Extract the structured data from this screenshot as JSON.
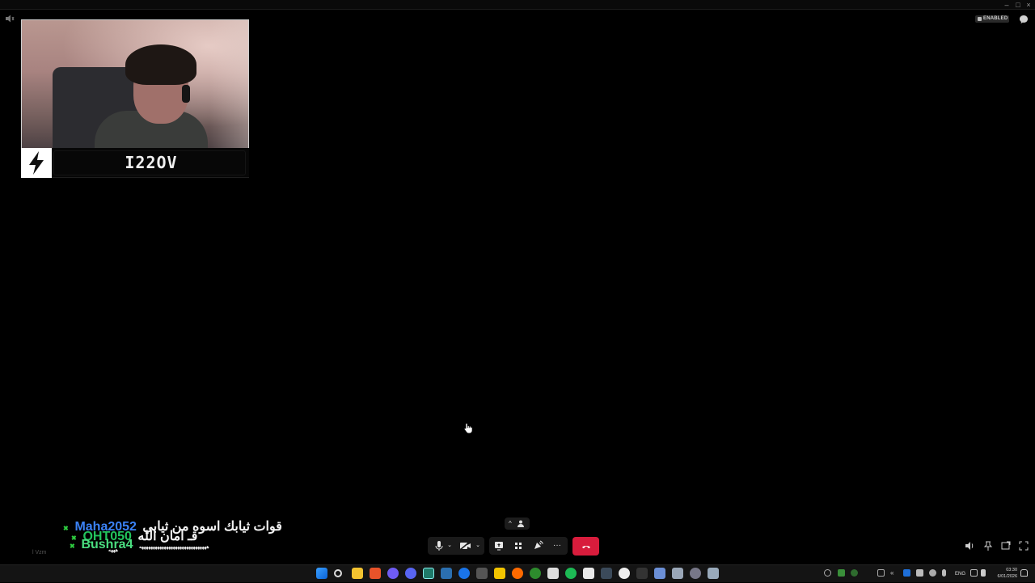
{
  "window": {
    "status_badge": "ENABLED"
  },
  "participant": {
    "name": "I22OV"
  },
  "chat": {
    "messages": [
      {
        "user": "Maha2052",
        "user_color": "#3b82f6",
        "text": "قوات ثيابك اسوه من ثيابي"
      },
      {
        "user": "QHT050",
        "user_color": "#22c55e",
        "text": "قـ امان الله"
      },
      {
        "user": "Bushra4",
        "user_color": "#4ade80",
        "text": "ههههههههههههههههههههههههههههههه"
      }
    ],
    "continuation": "هههه",
    "viewer_tag": "l Vzm"
  },
  "controls": {
    "mic_icon": "microphone-icon",
    "camera_icon": "camera-off-icon",
    "share_icon": "screen-share-icon",
    "activities_icon": "apps-grid-icon",
    "soundboard_icon": "soundboard-icon",
    "more_label": "···",
    "hangup_icon": "phone-hangup-icon"
  },
  "taskbar": {
    "language": "ENG",
    "time": "03:30",
    "date": "6/01/2026"
  },
  "colors": {
    "hangup": "#d81c3c",
    "background": "#000000",
    "taskbar": "#141414"
  }
}
